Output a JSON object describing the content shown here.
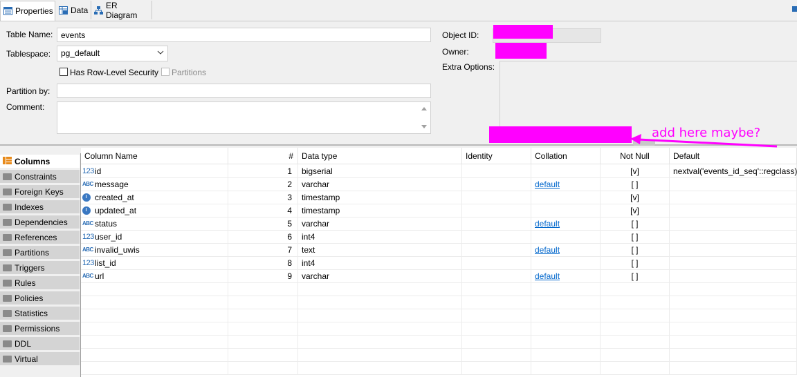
{
  "tabs": [
    {
      "label": "Properties",
      "icon": "properties-icon",
      "active": true
    },
    {
      "label": "Data",
      "icon": "data-grid-icon",
      "active": false
    },
    {
      "label": "ER Diagram",
      "icon": "er-diagram-icon",
      "active": false
    }
  ],
  "form": {
    "table_name_label": "Table Name:",
    "table_name_value": "events",
    "tablespace_label": "Tablespace:",
    "tablespace_value": "pg_default",
    "row_level_security_label": "Has Row-Level Security",
    "partitions_label": "Partitions",
    "partition_by_label": "Partition by:",
    "partition_by_value": "",
    "comment_label": "Comment:",
    "comment_value": "",
    "object_id_label": "Object ID:",
    "owner_label": "Owner:",
    "extra_options_label": "Extra Options:"
  },
  "annotation": {
    "text": "add here maybe?",
    "color": "#ff00ff"
  },
  "nav": [
    {
      "label": "Columns",
      "active": true
    },
    {
      "label": "Constraints"
    },
    {
      "label": "Foreign Keys"
    },
    {
      "label": "Indexes"
    },
    {
      "label": "Dependencies"
    },
    {
      "label": "References"
    },
    {
      "label": "Partitions"
    },
    {
      "label": "Triggers"
    },
    {
      "label": "Rules"
    },
    {
      "label": "Policies"
    },
    {
      "label": "Statistics"
    },
    {
      "label": "Permissions"
    },
    {
      "label": "DDL"
    },
    {
      "label": "Virtual"
    }
  ],
  "columns_table": {
    "headers": [
      "Column Name",
      "#",
      "Data type",
      "Identity",
      "Collation",
      "Not Null",
      "Default"
    ],
    "rows": [
      {
        "icon": "number-type-icon",
        "name": "id",
        "num": "1",
        "type": "bigserial",
        "identity": "",
        "collation": "",
        "not_null": "[v]",
        "default": "nextval('events_id_seq'::regclass)"
      },
      {
        "icon": "text-type-icon",
        "name": "message",
        "num": "2",
        "type": "varchar",
        "identity": "",
        "collation": "default",
        "not_null": "[ ]",
        "default": ""
      },
      {
        "icon": "time-type-icon",
        "name": "created_at",
        "num": "3",
        "type": "timestamp",
        "identity": "",
        "collation": "",
        "not_null": "[v]",
        "default": ""
      },
      {
        "icon": "time-type-icon",
        "name": "updated_at",
        "num": "4",
        "type": "timestamp",
        "identity": "",
        "collation": "",
        "not_null": "[v]",
        "default": ""
      },
      {
        "icon": "text-type-icon",
        "name": "status",
        "num": "5",
        "type": "varchar",
        "identity": "",
        "collation": "default",
        "not_null": "[ ]",
        "default": ""
      },
      {
        "icon": "number-type-icon",
        "name": "user_id",
        "num": "6",
        "type": "int4",
        "identity": "",
        "collation": "",
        "not_null": "[ ]",
        "default": ""
      },
      {
        "icon": "text-type-icon",
        "name": "invalid_uwis",
        "num": "7",
        "type": "text",
        "identity": "",
        "collation": "default",
        "not_null": "[ ]",
        "default": ""
      },
      {
        "icon": "number-type-icon",
        "name": "list_id",
        "num": "8",
        "type": "int4",
        "identity": "",
        "collation": "",
        "not_null": "[ ]",
        "default": ""
      },
      {
        "icon": "text-type-icon",
        "name": "url",
        "num": "9",
        "type": "varchar",
        "identity": "",
        "collation": "default",
        "not_null": "[ ]",
        "default": ""
      }
    ]
  }
}
